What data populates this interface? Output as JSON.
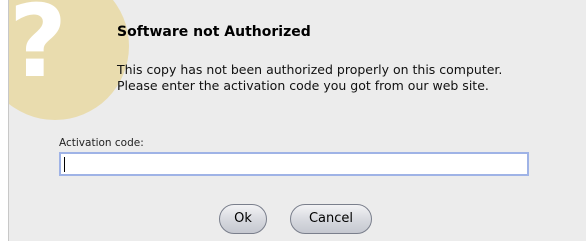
{
  "dialog": {
    "title": "Software not Authorized",
    "message_line1": "This copy has not been authorized properly on this computer.",
    "message_line2": "Please enter the activation code you got from our web site.",
    "field_label": "Activation code:",
    "field_value": "",
    "icon": "question-mark-icon",
    "icon_glyph": "?",
    "icon_color": "#e9dcae",
    "ok_label": "Ok",
    "cancel_label": "Cancel"
  }
}
